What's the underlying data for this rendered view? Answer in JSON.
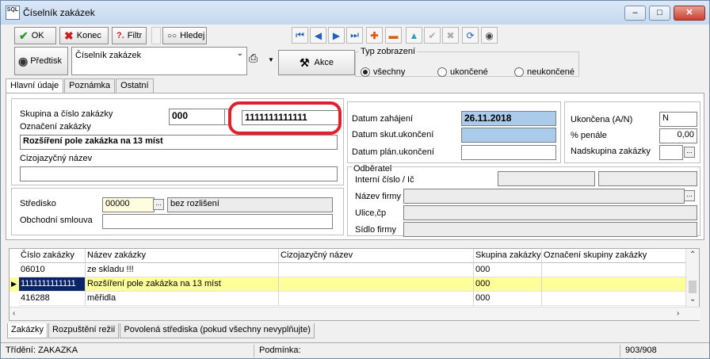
{
  "window": {
    "title": "Číselník zakázek",
    "icon_text": "SQL"
  },
  "toolbar": {
    "ok_label": "OK",
    "konec_label": "Konec",
    "filtr_label": "Filtr",
    "hledej_label": "Hledej",
    "predtisk_label": "Předtisk",
    "akce_label": "Akce"
  },
  "report_combo": {
    "value": "Číselník zakázek"
  },
  "typ_zobrazeni": {
    "legend": "Typ zobrazení",
    "options": [
      "všechny",
      "ukončené",
      "neukončené"
    ],
    "selected": "všechny"
  },
  "tabs_top": [
    "Hlavní údaje",
    "Poznámka",
    "Ostatní"
  ],
  "form": {
    "skupina_label": "Skupina a číslo zakázky",
    "skupina_value": "000",
    "cislo_value": "1111111111111",
    "oznaceni_label": "Označení zakázky",
    "oznaceni_value": "Rozšíření pole zakázka na 13 míst",
    "cizojazycny_label": "Cizojazyčný název",
    "cizojazycny_value": "",
    "stredisko_label": "Středisko",
    "stredisko_value": "00000",
    "stredisko_nazev": "bez rozlišení",
    "obchodni_label": "Obchodní smlouva",
    "obchodni_value": "",
    "datum_zahajeni_label": "Datum zahájení",
    "datum_zahajeni_value": "26.11.2018",
    "datum_skut_label": "Datum skut.ukončení",
    "datum_skut_value": "",
    "datum_plan_label": "Datum plán.ukončení",
    "datum_plan_value": "",
    "ukoncena_label": "Ukončena (A/N)",
    "ukoncena_value": "N",
    "penale_label": "% penále",
    "penale_value": "0,00",
    "nadskupina_label": "Nadskupina zakázky",
    "nadskupina_value": "",
    "odberatel_label": "Odběratel",
    "interni_label": "Interní číslo / Ič",
    "nazev_firmy_label": "Název firmy",
    "ulice_label": "Ulice,čp",
    "sidlo_label": "Sídlo firmy"
  },
  "table": {
    "columns": [
      "Číslo zakázky",
      "Název zakázky",
      "Cizojazyčný název",
      "Skupina zakázky",
      "Označení skupiny zakázky"
    ],
    "rows": [
      [
        "06010",
        "ze skladu !!!",
        "",
        "000",
        ""
      ],
      [
        "1111111111111",
        "Rozšíření pole zakázka na 13 míst",
        "",
        "000",
        ""
      ],
      [
        "416288",
        "měřidla",
        "",
        "000",
        ""
      ]
    ]
  },
  "tabs_bottom": [
    "Zakázky",
    "Rozpuštění režií",
    "Povolená střediska (pokud všechny nevyplňujte)"
  ],
  "status": {
    "trideni": "Třídění: ZAKAZKA",
    "podminka": "Podmínka:",
    "count": "903/908"
  }
}
